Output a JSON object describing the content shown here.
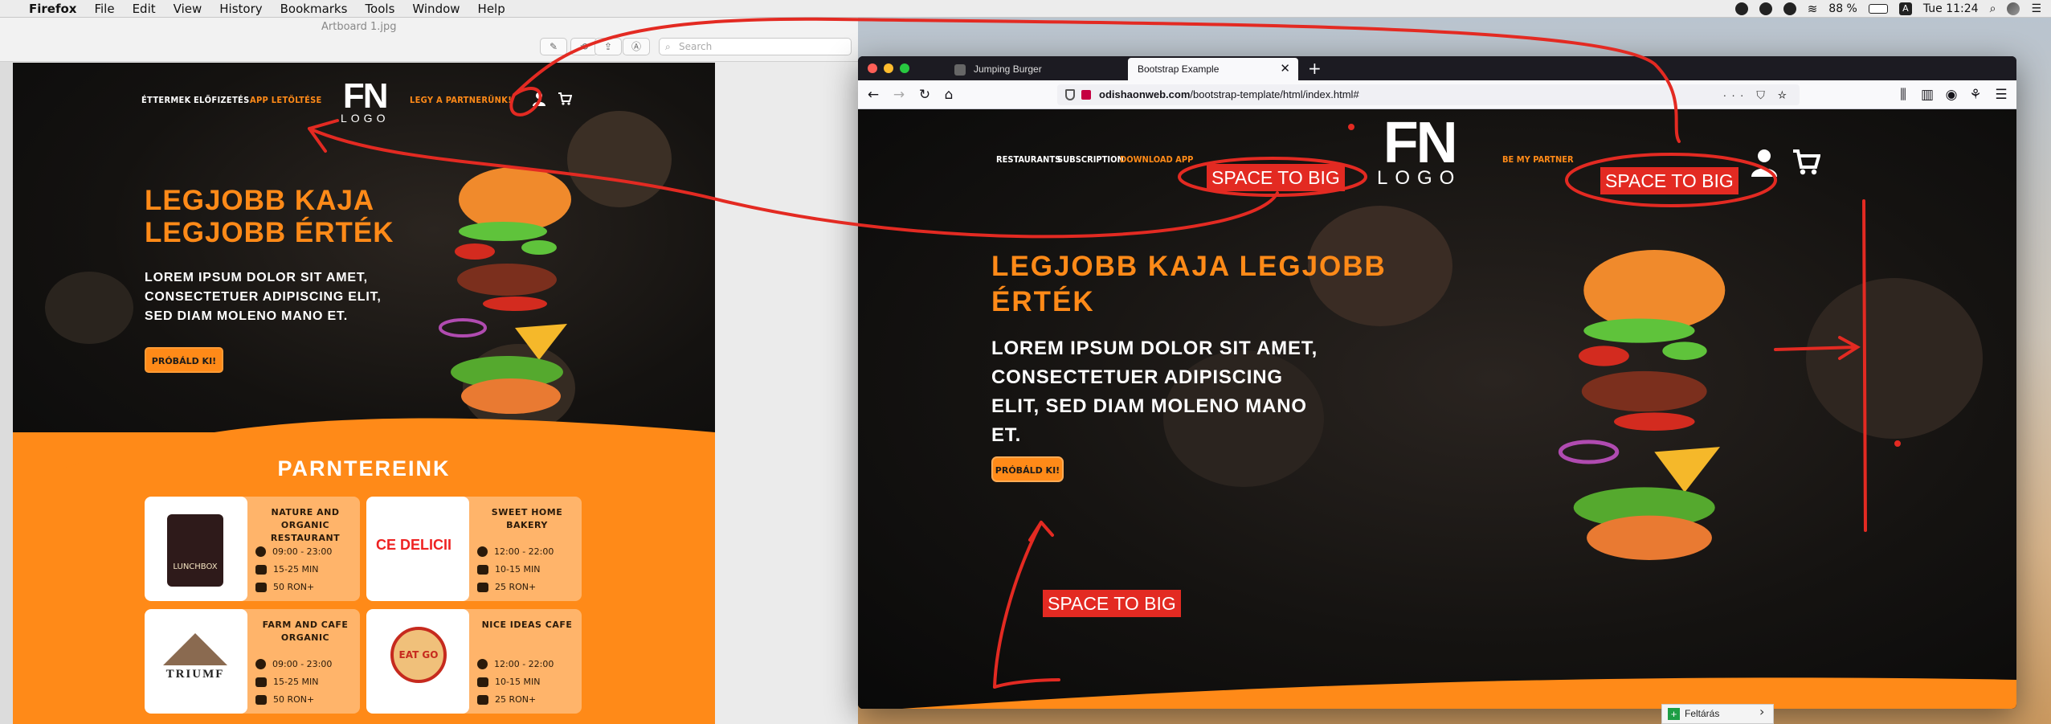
{
  "menubar": {
    "app": "Firefox",
    "items": [
      "File",
      "Edit",
      "View",
      "History",
      "Bookmarks",
      "Tools",
      "Window",
      "Help"
    ],
    "battery": "88 %",
    "clock": "Tue 11:24"
  },
  "preview": {
    "doc_title": "Artboard 1.jpg",
    "search_placeholder": "Search"
  },
  "artboard": {
    "nav": {
      "restaurants": "ÉTTERMEK",
      "subscription": "ELŐFIZETÉS",
      "download": "APP LETÖLTÉSE",
      "partner": "LEGY A PARTNERÜNK!"
    },
    "logo": {
      "fn": "FN",
      "word": "LOGO"
    },
    "headline": "LEGJOBB KAJA LEGJOBB ÉRTÉK",
    "sub": "LOREM IPSUM DOLOR SIT AMET, CONSECTETUER ADIPISCING ELIT, SED DIAM MOLENO MANO ET.",
    "cta": "PRÓBÁLD KI!",
    "partners_title": "PARNTEREINK",
    "partners": [
      {
        "name": "NATURE AND ORGANIC RESTAURANT",
        "hours": "09:00 - 23:00",
        "time": "15-25 MIN",
        "price": "50 RON+",
        "logo": "LUNCHBOX"
      },
      {
        "name": "SWEET HOME BAKERY",
        "hours": "12:00 - 22:00",
        "time": "10-15 MIN",
        "price": "25 RON+",
        "logo": "CE DELICII"
      },
      {
        "name": "FARM AND CAFE ORGANIC",
        "hours": "09:00 - 23:00",
        "time": "15-25 MIN",
        "price": "50 RON+",
        "logo": "TRIUMF"
      },
      {
        "name": "NICE IDEAS CAFE",
        "hours": "12:00 - 22:00",
        "time": "10-15 MIN",
        "price": "25 RON+",
        "logo": "EAT GO"
      }
    ]
  },
  "firefox": {
    "tabs": [
      {
        "label": "Jumping Burger",
        "active": false
      },
      {
        "label": "Bootstrap Example",
        "active": true
      }
    ],
    "url_host": "odishaonweb.com",
    "url_path": "/bootstrap-template/html/index.html#",
    "site": {
      "nav": {
        "restaurants": "RESTAURANTS",
        "subscription": "SUBSCRIPTION",
        "download": "DOWNLOAD APP",
        "partner": "BE MY PARTNER"
      },
      "logo": {
        "fn": "FN",
        "word": "LOGO"
      },
      "headline": "LEGJOBB KAJA LEGJOBB ÉRTÉK",
      "sub": "LOREM IPSUM DOLOR SIT AMET, CONSECTETUER ADIPISCING ELIT, SED DIAM MOLENO MANO ET.",
      "cta": "PRÓBÁLD KI!"
    }
  },
  "annotations": {
    "label_1": "SPACE TO BIG",
    "label_2": "SPACE TO BIG",
    "label_3": "SPACE TO BIG",
    "color": "#e32a22"
  },
  "finder": {
    "label": "Feltárás"
  },
  "colors": {
    "brand_orange": "#ff8a18",
    "dark_bg": "#0f0f0f"
  }
}
